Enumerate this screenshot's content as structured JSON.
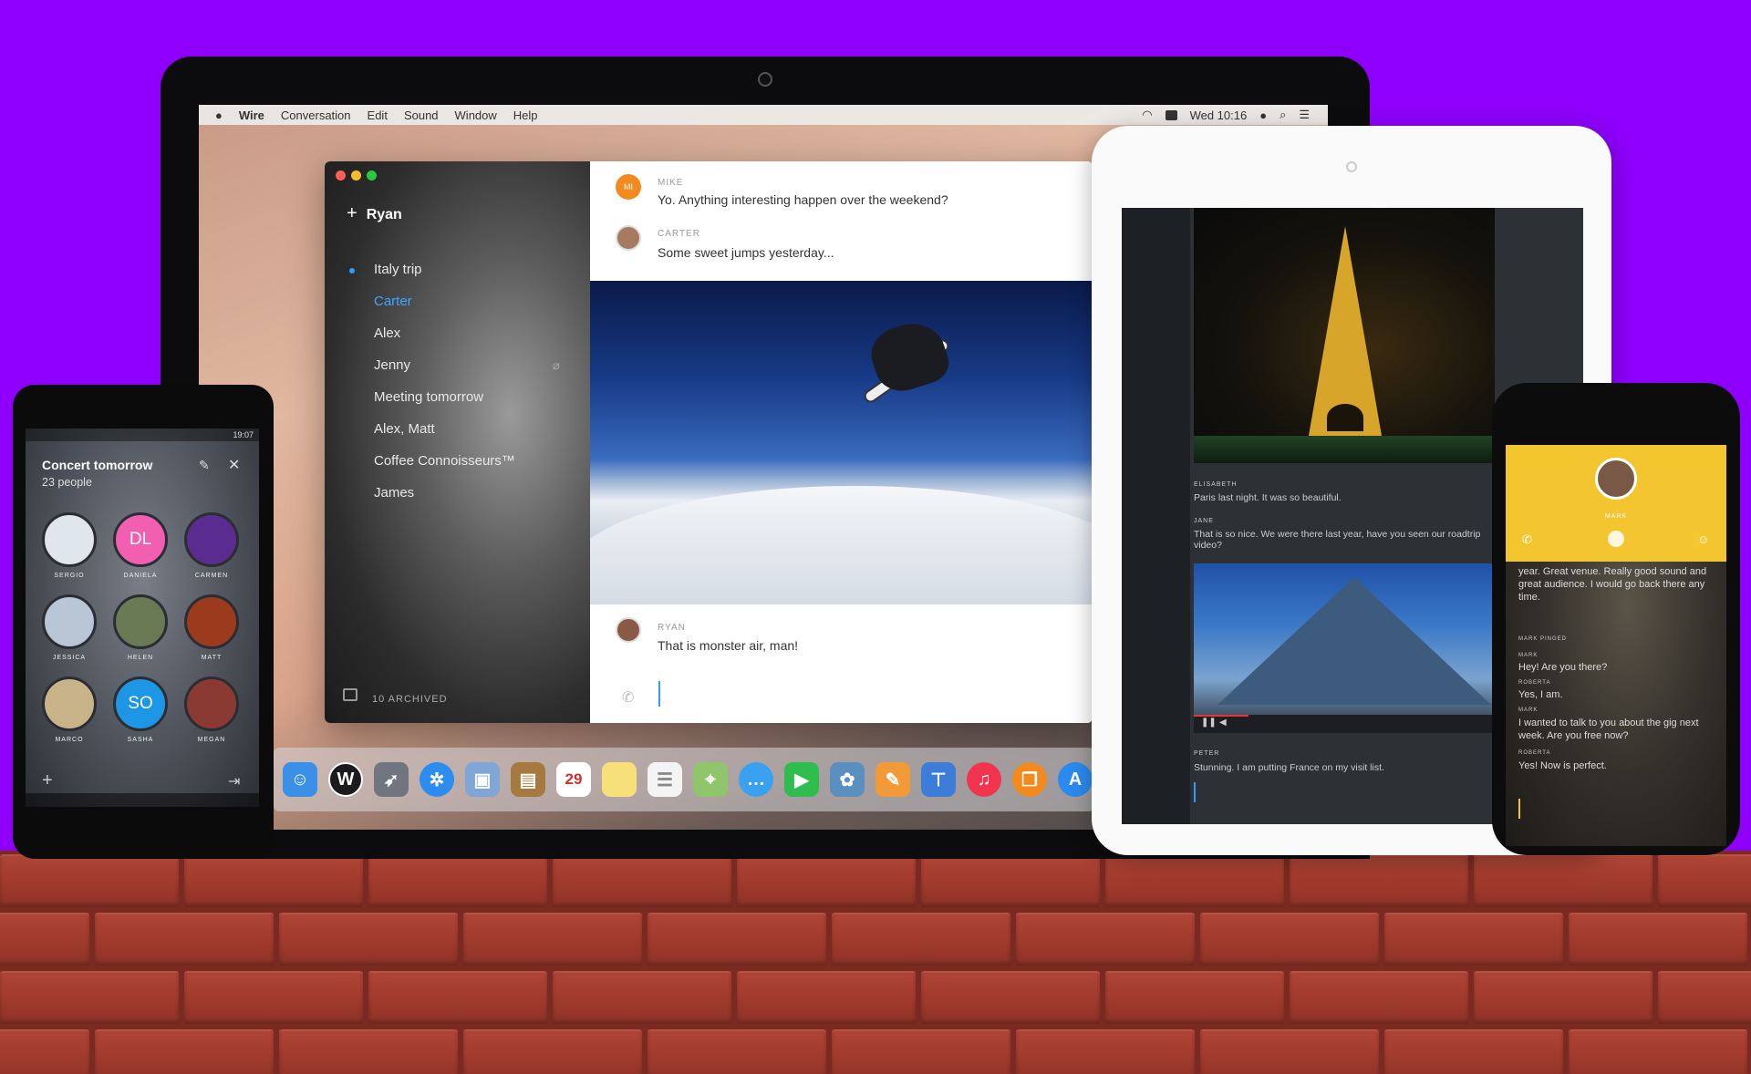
{
  "mac": {
    "menubar": {
      "app_name": "Wire",
      "menus": [
        "Conversation",
        "Edit",
        "Sound",
        "Window",
        "Help"
      ],
      "clock": "Wed 10:16"
    },
    "sidebar": {
      "user": "Ryan",
      "conversations": [
        "Italy trip",
        "Carter",
        "Alex",
        "Jenny",
        "Meeting tomorrow",
        "Alex, Matt",
        "Coffee Connoisseurs™",
        "James"
      ],
      "archived": "10 ARCHIVED"
    },
    "messages": [
      {
        "sender": "MIKE",
        "text": "Yo. Anything interesting happen over the weekend?",
        "initials": "MI"
      },
      {
        "sender": "CARTER",
        "text": "Some sweet jumps yesterday..."
      },
      {
        "sender": "RYAN",
        "text": "That is monster air, man!"
      }
    ],
    "dock_icons": [
      "finder-icon",
      "wire-icon",
      "launchpad-icon",
      "safari-icon",
      "preview-icon",
      "contacts-icon",
      "calendar-icon",
      "notes-icon",
      "reminders-icon",
      "maps-icon",
      "messages-icon",
      "facetime-icon",
      "photos-icon",
      "pages-icon",
      "keynote-icon",
      "music-icon",
      "books-icon",
      "app-store-icon"
    ],
    "calendar_day": "29"
  },
  "tablet": {
    "messages": [
      {
        "sender": "ELISABETH",
        "text": "Paris last night. It was so beautiful."
      },
      {
        "sender": "JANE",
        "text": "That is so nice. We were there last year, have you seen our roadtrip video?"
      },
      {
        "sender": "PETER",
        "text": "Stunning. I am putting France on my visit list."
      }
    ]
  },
  "android": {
    "status_time": "19:07",
    "title": "Concert tomorrow",
    "subtitle": "23 people",
    "people": [
      {
        "name": "SERGIO",
        "initials": "",
        "color": "#dfe6ee"
      },
      {
        "name": "DANIELA",
        "initials": "DL",
        "color": "#f25fb0"
      },
      {
        "name": "CARMEN",
        "initials": "",
        "color": "#5b2c8f"
      },
      {
        "name": "JESSICA",
        "initials": "",
        "color": "#b9c6d6"
      },
      {
        "name": "HELEN",
        "initials": "",
        "color": "#6a7a54"
      },
      {
        "name": "MATT",
        "initials": "",
        "color": "#9c3a1e"
      },
      {
        "name": "MARCO",
        "initials": "",
        "color": "#c9b48a"
      },
      {
        "name": "SASHA",
        "initials": "SO",
        "color": "#1e96e6"
      },
      {
        "name": "MEGAN",
        "initials": "",
        "color": "#8a3a30"
      }
    ]
  },
  "iphone": {
    "header_name": "MARK",
    "top_text": "year. Great venue. Really good sound and great audience. I would go back there any time.",
    "messages": [
      {
        "sender": "MARK PINGED",
        "text": ""
      },
      {
        "sender": "MARK",
        "text": "Hey! Are you there?"
      },
      {
        "sender": "ROBERTA",
        "text": "Yes, I am."
      },
      {
        "sender": "MARK",
        "text": "I wanted to talk to you about the gig next week. Are you free now?"
      },
      {
        "sender": "ROBERTA",
        "text": "Yes! Now is perfect."
      }
    ]
  },
  "colors": {
    "background": "#8e00fb",
    "brick": "#a03a2d",
    "accent_blue": "#2f9cff",
    "iphone_header": "#f3c52f"
  }
}
